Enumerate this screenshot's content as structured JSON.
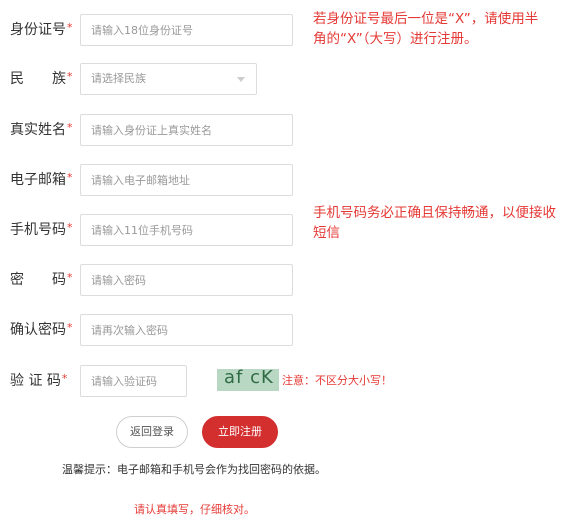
{
  "form": {
    "id_card": {
      "label": "身份证号",
      "required_mark": "*",
      "placeholder": "请输入18位身份证号",
      "value": ""
    },
    "ethnicity": {
      "label_left": "民",
      "label_right": "族",
      "required_mark": "*",
      "selected": "请选择民族",
      "icon": "chevron-down-icon"
    },
    "real_name": {
      "label": "真实姓名",
      "required_mark": "*",
      "placeholder": "请输入身份证上真实姓名",
      "value": ""
    },
    "email": {
      "label": "电子邮箱",
      "required_mark": "*",
      "placeholder": "请输入电子邮箱地址",
      "value": ""
    },
    "phone": {
      "label": "手机号码",
      "required_mark": "*",
      "placeholder": "请输入11位手机号码",
      "value": ""
    },
    "password": {
      "label_left": "密",
      "label_right": "码",
      "required_mark": "*",
      "placeholder": "请输入密码",
      "value": ""
    },
    "confirm_password": {
      "label": "确认密码",
      "required_mark": "*",
      "placeholder": "请再次输入密码",
      "value": ""
    },
    "captcha": {
      "label": "验 证 码",
      "required_mark": "*",
      "placeholder": "请输入验证码",
      "value": "",
      "image_text": "af cK",
      "note": "注意：不区分大小写！"
    }
  },
  "notes": {
    "id_card_line1": "若身份证号最后一位是“X”，请使用半",
    "id_card_line2": "角的“X”（大写）进行注册。",
    "phone_line1": "手机号码务必正确且保持畅通，以便接收",
    "phone_line2": "短信"
  },
  "buttons": {
    "back": "返回登录",
    "submit": "立即注册"
  },
  "footer": {
    "tip": "温馨提示：电子邮箱和手机号会作为找回密码的依据。",
    "warning": "请认真填写，仔细核对。"
  },
  "colors": {
    "accent": "#d32f2f",
    "warning_text": "#e53935",
    "captcha_bg": "#b9d8c4"
  }
}
